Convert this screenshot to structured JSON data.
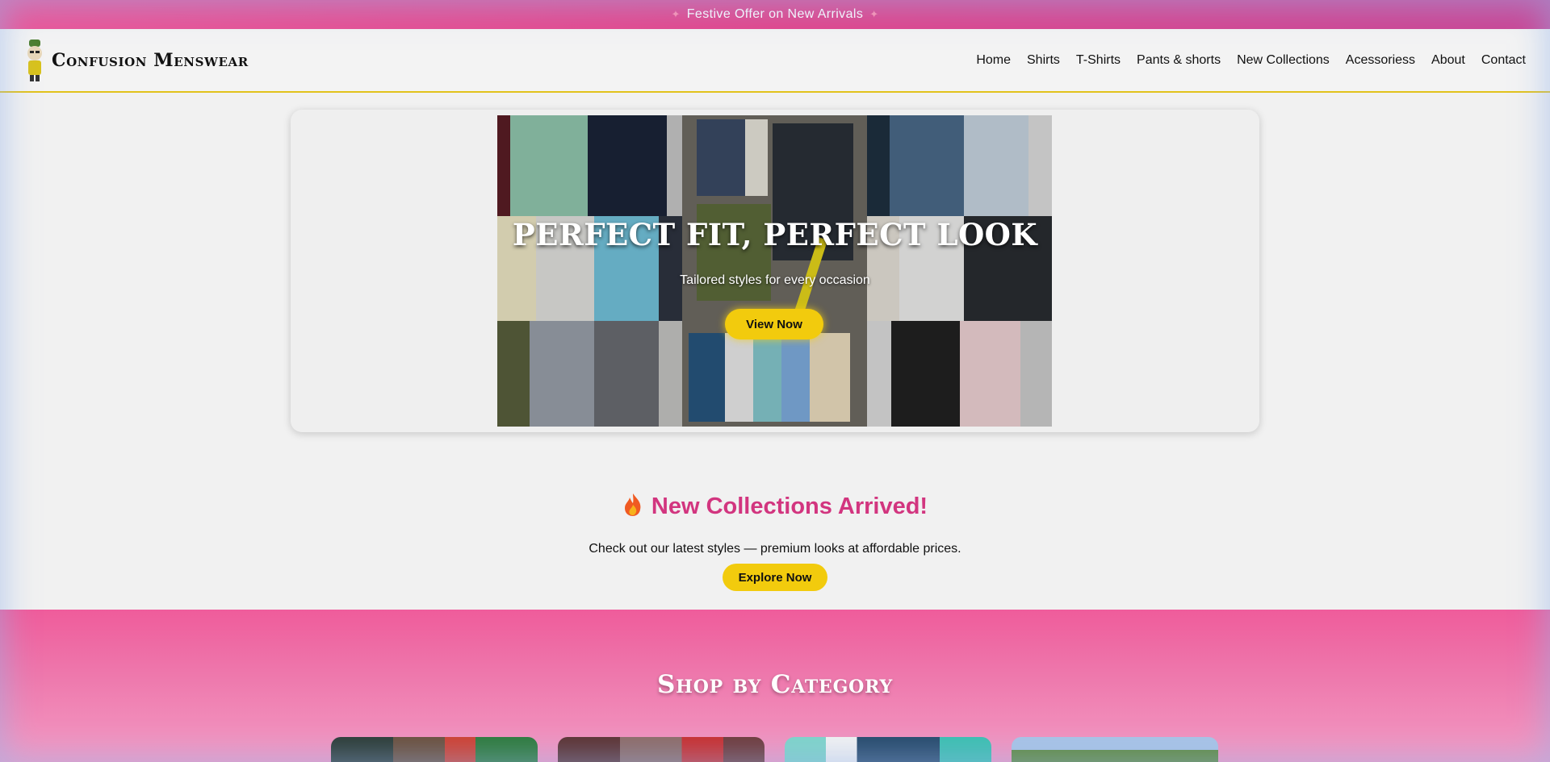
{
  "offer_bar": {
    "text": "Festive Offer on New Arrivals",
    "left_icon": "sparkle-icon",
    "right_icon": "sparkle-icon"
  },
  "header": {
    "logo_icon": "mascot-logo-icon",
    "brand": "Confusion Menswear",
    "nav": [
      {
        "label": "Home"
      },
      {
        "label": "Shirts"
      },
      {
        "label": "T-Shirts"
      },
      {
        "label": "Pants & shorts"
      },
      {
        "label": "New Collections"
      },
      {
        "label": "Acessoriess"
      },
      {
        "label": "About"
      },
      {
        "label": "Contact"
      }
    ]
  },
  "hero": {
    "title": "PERFECT FIT, PERFECT LOOK",
    "subtitle": "Tailored styles for every occasion",
    "button": "View Now"
  },
  "new_collections": {
    "icon": "fire-icon",
    "title": "New Collections Arrived!",
    "text": "Check out our latest styles — premium looks at affordable prices.",
    "button": "Explore Now"
  },
  "shop_by_category": {
    "title": "Shop by Category"
  },
  "colors": {
    "accent_pink": "#d2357f",
    "button_yellow": "#f2cb0d",
    "header_border": "#e2c21c",
    "banner_pink": "#ef5c9b"
  }
}
